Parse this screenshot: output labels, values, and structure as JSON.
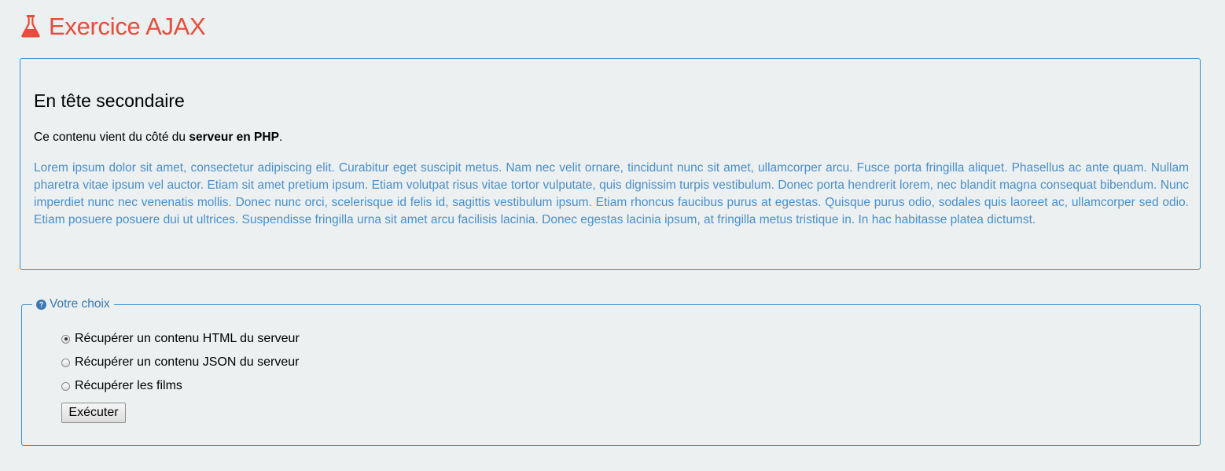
{
  "header": {
    "title": "Exercice AJAX",
    "icon": "flask-icon",
    "color": "#e74c3c"
  },
  "panel": {
    "heading": "En tête secondaire",
    "intro_before": "Ce contenu vient du côté du ",
    "intro_bold": "serveur en PHP",
    "intro_after": ".",
    "lorem": "Lorem ipsum dolor sit amet, consectetur adipiscing elit. Curabitur eget suscipit metus. Nam nec velit ornare, tincidunt nunc sit amet, ullamcorper arcu. Fusce porta fringilla aliquet. Phasellus ac ante quam. Nullam pharetra vitae ipsum vel auctor. Etiam sit amet pretium ipsum. Etiam volutpat risus vitae tortor vulputate, quis dignissim turpis vestibulum. Donec porta hendrerit lorem, nec blandit magna consequat bibendum. Nunc imperdiet nunc nec venenatis mollis. Donec nunc orci, scelerisque id felis id, sagittis vestibulum ipsum. Etiam rhoncus faucibus purus at egestas. Quisque purus odio, sodales quis laoreet ac, ullamcorper sed odio. Etiam posuere posuere dui ut ultrices. Suspendisse fringilla urna sit amet arcu facilisis lacinia. Donec egestas lacinia ipsum, at fringilla metus tristique in. In hac habitasse platea dictumst.",
    "border_color": "#3c8dcd",
    "lorem_color": "#4a8fcb"
  },
  "choice": {
    "legend": "Votre choix",
    "legend_icon": "question-circle-icon",
    "options": [
      {
        "label": "Récupérer un contenu HTML du serveur",
        "checked": true
      },
      {
        "label": "Récupérer un contenu JSON du serveur",
        "checked": false
      },
      {
        "label": "Récupérer les films",
        "checked": false
      }
    ],
    "button_label": "Exécuter"
  }
}
